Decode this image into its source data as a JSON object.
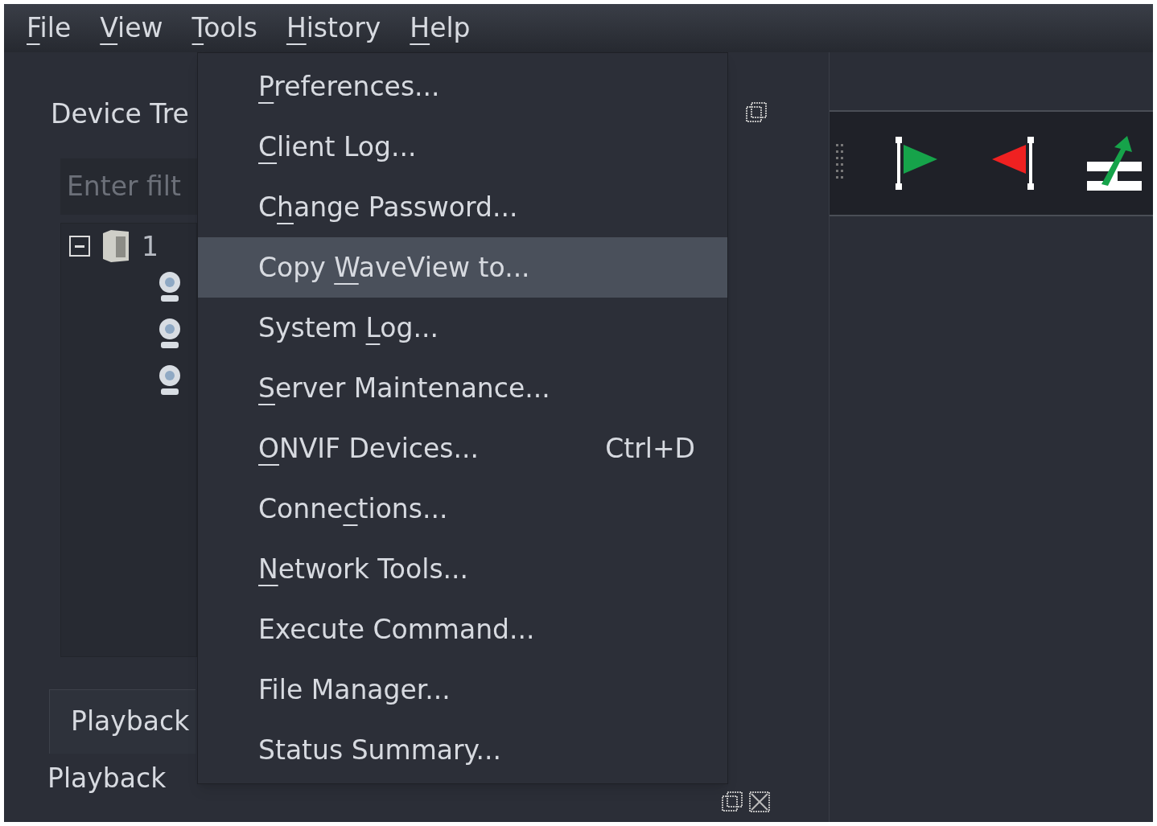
{
  "menubar": [
    {
      "key": "F",
      "rest": "ile"
    },
    {
      "key": "V",
      "rest": "iew"
    },
    {
      "key": "T",
      "rest": "ools"
    },
    {
      "key": "H",
      "rest": "istory"
    },
    {
      "key": "H",
      "rest": "elp"
    }
  ],
  "tools_menu": [
    {
      "key": "P",
      "rest": "references...",
      "selected": false
    },
    {
      "key": "C",
      "rest": "lient Log...",
      "selected": false
    },
    {
      "lead": "C",
      "key": "h",
      "rest": "ange Password...",
      "selected": false
    },
    {
      "lead": "Copy ",
      "key": "W",
      "rest": "aveView to...",
      "selected": true
    },
    {
      "lead": "System ",
      "key": "L",
      "rest": "og...",
      "selected": false
    },
    {
      "key": "S",
      "rest": "erver Maintenance...",
      "selected": false
    },
    {
      "key": "O",
      "rest": "NVIF Devices...",
      "shortcut": "Ctrl+D",
      "selected": false
    },
    {
      "lead": "Conne",
      "key": "c",
      "rest": "tions...",
      "selected": false
    },
    {
      "key": "N",
      "rest": "etwork Tools...",
      "selected": false
    },
    {
      "lead": "Execute Command...",
      "selected": false
    },
    {
      "lead": "File Manager...",
      "selected": false
    },
    {
      "lead": "Status Summary...",
      "selected": false
    }
  ],
  "device_tree": {
    "title": "Device Tre",
    "filter": {
      "placeholder": "Enter filt"
    },
    "nodes": [
      {
        "kind": "server",
        "label": "1",
        "expanded": true,
        "children": [
          {
            "kind": "camera"
          },
          {
            "kind": "camera"
          },
          {
            "kind": "camera"
          }
        ]
      }
    ]
  },
  "bottom_dock": {
    "tab": "Playback",
    "title": "Playback"
  }
}
